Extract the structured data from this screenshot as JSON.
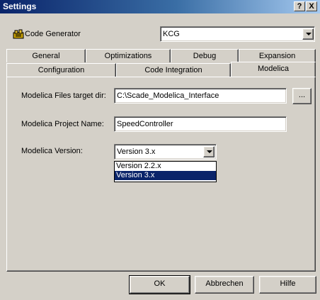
{
  "window": {
    "title": "Settings",
    "help_btn": "?",
    "close_btn": "X"
  },
  "generator": {
    "label": "Code Generator",
    "value": "KCG"
  },
  "tabs": {
    "row_back": [
      "General",
      "Optimizations",
      "Debug",
      "Expansion"
    ],
    "row_front": [
      "Configuration",
      "Code Integration",
      "Modelica"
    ],
    "active": "Modelica"
  },
  "form": {
    "target_dir_label": "Modelica Files target dir:",
    "target_dir_value": "C:\\Scade_Modelica_Interface",
    "browse_label": "...",
    "project_name_label": "Modelica Project Name:",
    "project_name_value": "SpeedController",
    "version_label": "Modelica Version:",
    "version_value": "Version 3.x",
    "version_options": [
      "Version 2.2.x",
      "Version 3.x"
    ],
    "version_selected": "Version 3.x"
  },
  "buttons": {
    "ok": "OK",
    "cancel": "Abbrechen",
    "help": "Hilfe"
  }
}
